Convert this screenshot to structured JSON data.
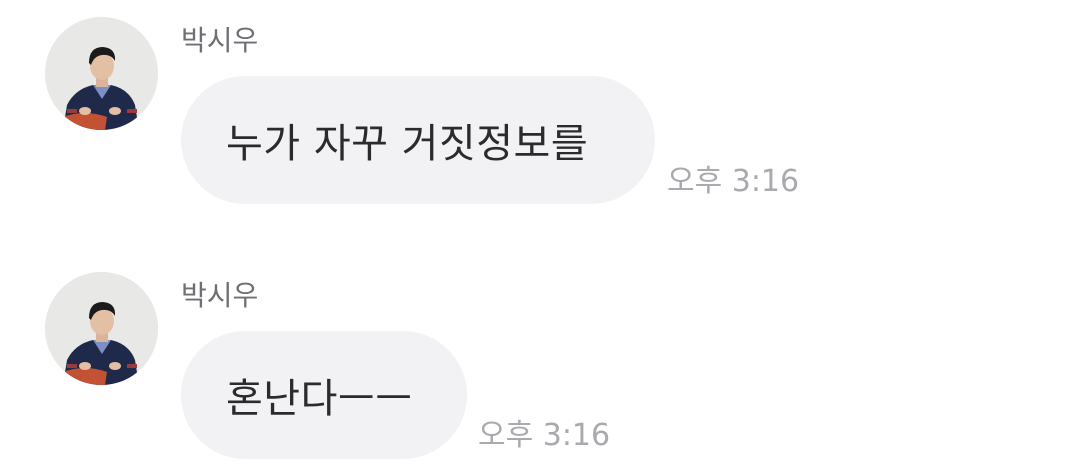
{
  "messages": [
    {
      "sender": "박시우",
      "text": "누가 자꾸 거짓정보를",
      "time": "오후 3:16"
    },
    {
      "sender": "박시우",
      "text": "혼난다ㅡㅡ",
      "time": "오후 3:16"
    }
  ],
  "colors": {
    "bubble": "#f2f2f5",
    "sender": "#6f6f73",
    "time": "#a9a9ae",
    "text": "#2b2b2e"
  }
}
